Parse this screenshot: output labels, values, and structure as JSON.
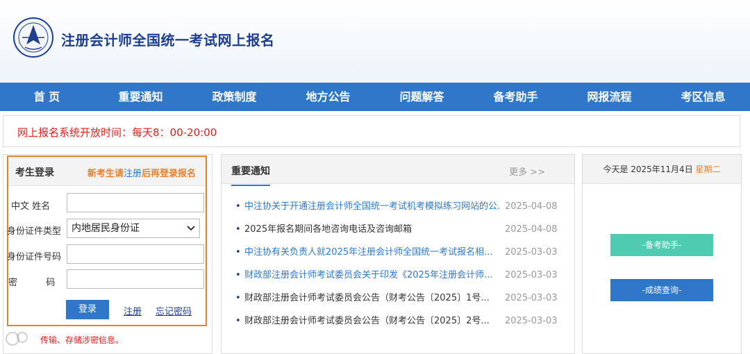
{
  "header": {
    "site_title": "注册会计师全国统一考试网上报名",
    "logo": "cicpa-emblem-icon"
  },
  "nav": {
    "items": [
      "首 页",
      "重要通知",
      "政策制度",
      "地方公告",
      "问题解答",
      "备考助手",
      "网报流程",
      "考区信息"
    ]
  },
  "notice": {
    "text": "网上报名系统开放时间：每天8：00-20:00"
  },
  "login": {
    "title": "考生登录",
    "hint_prefix": "新考生请",
    "hint_register": "注册",
    "hint_suffix": "后再登录报名",
    "name_label": "中文  姓名",
    "id_type_label": "身份证件类型",
    "id_type_value": "内地居民身份证",
    "id_number_label": "身份证件号码",
    "password_label": "密        码",
    "login_button": "登录",
    "register_link": "注册",
    "forgot_link": "忘记密码",
    "warning": "传输、存储涉密信息。"
  },
  "news": {
    "title": "重要通知",
    "more": "更多 >>",
    "items": [
      {
        "title": "中注协关于开通注册会计师全国统一考试机考模拟练习网站的公...",
        "date": "2025-04-08",
        "color": "blue"
      },
      {
        "title": "2025年报名期间各地咨询电话及咨询邮箱",
        "date": "2025-04-08",
        "color": "dark"
      },
      {
        "title": "中注协有关负责人就2025年注册会计师全国统一考试报名相...",
        "date": "2025-03-03",
        "color": "blue"
      },
      {
        "title": "财政部注册会计师考试委员会关于印发《2025年注册会计师...",
        "date": "2025-03-03",
        "color": "blue"
      },
      {
        "title": "财政部注册会计师考试委员会公告（财考公告〔2025〕1号...",
        "date": "2025-03-03",
        "color": "dark"
      },
      {
        "title": "财政部注册会计师考试委员会公告（财考公告〔2025〕2号...",
        "date": "2025-03-03",
        "color": "dark"
      }
    ]
  },
  "right": {
    "today_prefix": "今天是 2025年11月4日",
    "weekday": "星期二",
    "helper_button": "-备考助手-",
    "score_button": "-成绩查询-"
  },
  "colors": {
    "nav_blue": "#3077c9",
    "title_blue": "#1e3f8f",
    "accent_orange": "#e8812b",
    "alert_red": "#e02020",
    "teal": "#4ecbb1"
  }
}
